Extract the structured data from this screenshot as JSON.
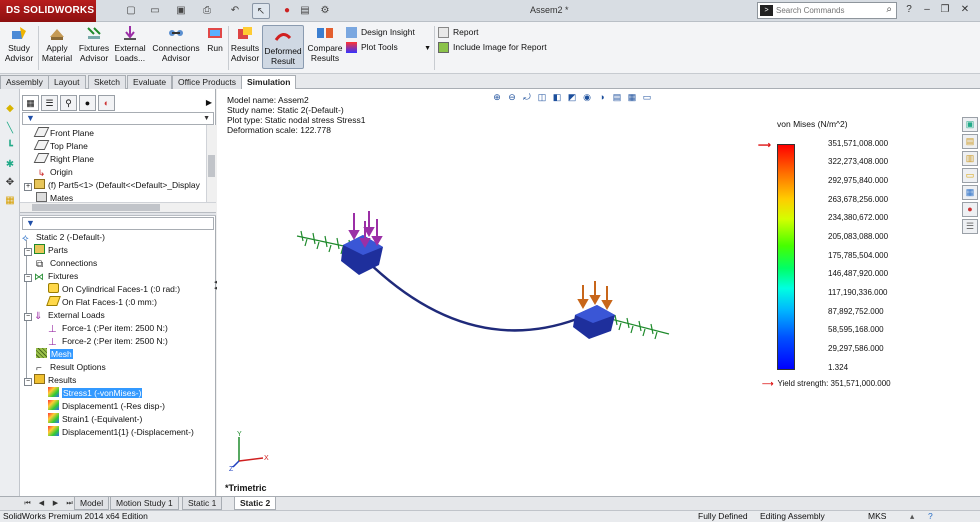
{
  "app": {
    "logo_text": "SOLIDWORKS",
    "logo_mark": "DS",
    "document_title": "Assem2 *",
    "search_placeholder": "Search Commands",
    "search_prefix": ">"
  },
  "ribbon": {
    "study_advisor": "Study\nAdvisor",
    "apply_material": "Apply\nMaterial",
    "fixtures_advisor": "Fixtures\nAdvisor",
    "external_loads": "External\nLoads...",
    "connections_advisor": "Connections\nAdvisor",
    "run": "Run",
    "results_advisor": "Results\nAdvisor",
    "deformed_result": "Deformed\nResult",
    "compare_results": "Compare\nResults",
    "design_insight": "Design Insight",
    "plot_tools": "Plot Tools",
    "report": "Report",
    "include_image": "Include Image for Report"
  },
  "command_tabs": [
    "Assembly",
    "Layout",
    "Sketch",
    "Evaluate",
    "Office Products",
    "Simulation"
  ],
  "feature_tree": {
    "upper": [
      "Front Plane",
      "Top Plane",
      "Right Plane",
      "Origin",
      "(f) Part5<1> (Default<<Default>_Display",
      "Mates"
    ],
    "study": "Static 2 (-Default-)",
    "parts": "Parts",
    "connections": "Connections",
    "fixtures": "Fixtures",
    "fixture_1": "On Cylindrical Faces-1 (:0 rad:)",
    "fixture_2": "On Flat Faces-1 (:0 mm:)",
    "external_loads": "External Loads",
    "force_1": "Force-1 (:Per item: 2500 N:)",
    "force_2": "Force-2 (:Per item: 2500 N:)",
    "mesh": "Mesh",
    "result_options": "Result Options",
    "results": "Results",
    "stress1": "Stress1 (-vonMises-)",
    "displacement1": "Displacement1 (-Res disp-)",
    "strain1": "Strain1 (-Equivalent-)",
    "displacement1_1": "Displacement1{1} (-Displacement-)"
  },
  "graphics": {
    "model_name": "Model name: Assem2",
    "study_name": "Study name: Static 2(-Default-)",
    "plot_type": "Plot type: Static nodal stress Stress1",
    "deformation_scale": "Deformation scale: 122.778",
    "view_orientation": "*Trimetric"
  },
  "legend": {
    "title": "von Mises (N/m^2)",
    "ticks": [
      "351,571,008.000",
      "322,273,408.000",
      "292,975,840.000",
      "263,678,256.000",
      "234,380,672.000",
      "205,083,088.000",
      "175,785,504.000",
      "146,487,920.000",
      "117,190,336.000",
      "87,892,752.000",
      "58,595,168.000",
      "29,297,586.000",
      "1.324"
    ],
    "yield_strength": "Yield strength: 351,571,000.000"
  },
  "bottom_tabs": [
    "Model",
    "Motion Study 1",
    "Static 1",
    "Static 2"
  ],
  "status": {
    "edition": "SolidWorks Premium 2014 x64 Edition",
    "defined": "Fully Defined",
    "mode": "Editing Assembly",
    "units": "MKS"
  },
  "colors": {
    "brand_red": "#b81d1d",
    "selection_blue": "#3399ff",
    "beam_blue": "#1f2a7a",
    "load_purple": "#9b2fa6",
    "load_orange": "#c8661a",
    "fixture_green": "#1f8a2c"
  }
}
